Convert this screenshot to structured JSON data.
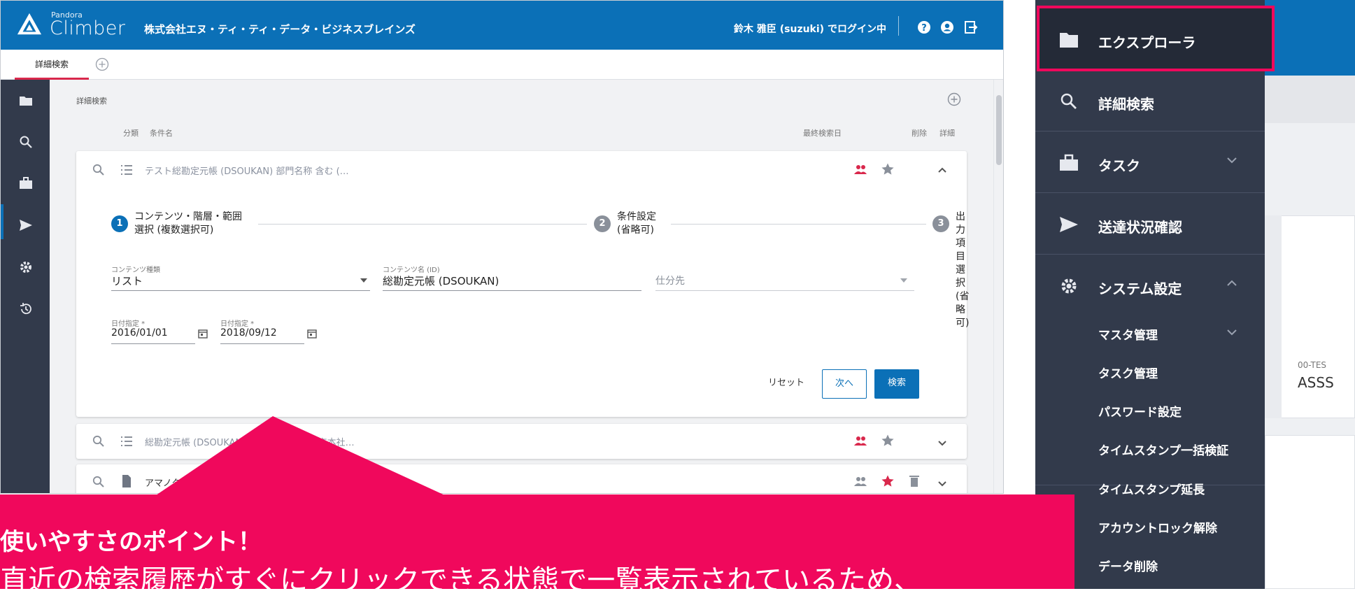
{
  "header": {
    "brand_small": "Pandora",
    "brand_name": "Climber",
    "company": "株式会社エヌ・ティ・ティ・データ・ビジネスブレインズ",
    "login_status": "鈴木 雅臣 (suzuki) でログイン中"
  },
  "tabs": {
    "active_label": "詳細検索"
  },
  "search": {
    "section_title": "詳細検索",
    "col_category": "分類",
    "col_condition": "条件名",
    "col_last_date": "最終検索日",
    "col_delete": "削除",
    "col_detail": "詳細",
    "rows": [
      {
        "title": "テスト総勘定元帳 (DSOUKAN)  部門名称 含む (…"
      },
      {
        "title": "総勘定元帳 (DSOUKAN)  部門名称 含む 東京本社…"
      },
      {
        "title": "アマノタイムスタンプ…"
      }
    ]
  },
  "steps": [
    {
      "num": "1",
      "line1": "コンテンツ・階層・範囲",
      "line2": "選択 (複数選択可)"
    },
    {
      "num": "2",
      "line1": "条件設定",
      "line2": "(省略可)"
    },
    {
      "num": "3",
      "line1": "出力項目選択",
      "line2": "(省略可)"
    }
  ],
  "form": {
    "content_type_label": "コンテンツ種類",
    "content_type_value": "リスト",
    "content_name_label": "コンテンツ名 (ID)",
    "content_name_value": "総勘定元帳 (DSOUKAN)",
    "split_placeholder": "仕分先",
    "date_from_label": "日付指定 *",
    "date_from_value": "2016/01/01",
    "date_to_label": "日付指定 *",
    "date_to_value": "2018/09/12",
    "reset_label": "リセット",
    "next_label": "次へ",
    "search_label": "検索"
  },
  "callout": {
    "title": "使いやすさのポイント！",
    "body": "直近の検索履歴がすぐにクリックできる状態で一覧表示されているため、"
  },
  "menu": {
    "items": [
      {
        "label": "エクスプローラ",
        "icon": "folder-icon"
      },
      {
        "label": "詳細検索",
        "icon": "search-icon"
      },
      {
        "label": "タスク",
        "icon": "briefcase-icon"
      },
      {
        "label": "送達状況確認",
        "icon": "send-icon"
      },
      {
        "label": "システム設定",
        "icon": "gear-icon"
      }
    ],
    "sub_items": [
      "マスタ管理",
      "タスク管理",
      "パスワード設定",
      "タイムスタンプ一括検証",
      "タイムスタンプ延長",
      "アカウントロック解除",
      "データ削除"
    ]
  },
  "right_cards": {
    "code_fragment": "00-TES",
    "name_fragment": "ASSS"
  },
  "colors": {
    "primary": "#0b70b7",
    "accent": "#f0085c",
    "menu_bg": "#323a4b",
    "badge_red": "#d9284c"
  }
}
